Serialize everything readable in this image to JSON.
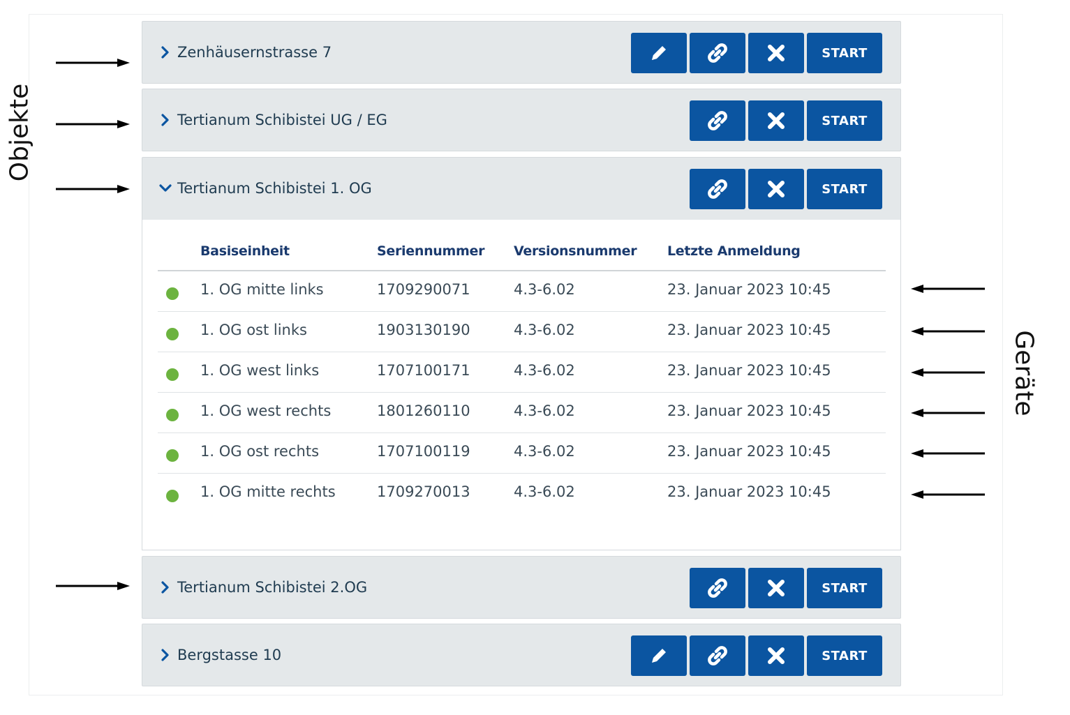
{
  "labels": {
    "objects": "Objekte",
    "devices": "Geräte"
  },
  "buttons": {
    "start_label": "START"
  },
  "objects": [
    {
      "name": "Zenhäusernstrasse 7",
      "expanded": false,
      "has_edit": true
    },
    {
      "name": "Tertianum Schibistei UG / EG",
      "expanded": false,
      "has_edit": false
    },
    {
      "name": "Tertianum Schibistei 1. OG",
      "expanded": true,
      "has_edit": false
    },
    {
      "name": "Tertianum Schibistei 2.OG",
      "expanded": false,
      "has_edit": false
    },
    {
      "name": "Bergstasse 10",
      "expanded": false,
      "has_edit": true
    }
  ],
  "device_table": {
    "headers": [
      "Basiseinheit",
      "Seriennummer",
      "Versionsnummer",
      "Letzte Anmeldung"
    ],
    "rows": [
      {
        "status": "online",
        "name": "1. OG mitte links",
        "serial": "1709290071",
        "version": "4.3-6.02",
        "last_login": "23. Januar 2023 10:45"
      },
      {
        "status": "online",
        "name": "1. OG ost links",
        "serial": "1903130190",
        "version": "4.3-6.02",
        "last_login": "23. Januar 2023 10:45"
      },
      {
        "status": "online",
        "name": "1. OG west links",
        "serial": "1707100171",
        "version": "4.3-6.02",
        "last_login": "23. Januar 2023 10:45"
      },
      {
        "status": "online",
        "name": "1. OG west rechts",
        "serial": "1801260110",
        "version": "4.3-6.02",
        "last_login": "23. Januar 2023 10:45"
      },
      {
        "status": "online",
        "name": "1. OG ost rechts",
        "serial": "1707100119",
        "version": "4.3-6.02",
        "last_login": "23. Januar 2023 10:45"
      },
      {
        "status": "online",
        "name": "1. OG mitte rechts",
        "serial": "1709270013",
        "version": "4.3-6.02",
        "last_login": "23. Januar 2023 10:45"
      }
    ]
  },
  "colors": {
    "button": "#0b55a1",
    "status_online": "#6cb33f",
    "header_bg": "#e4e8ea"
  },
  "icons": {
    "collapsed": "chevron-right-icon",
    "expanded": "chevron-down-icon",
    "edit": "pencil-icon",
    "link": "link-icon",
    "delete": "close-icon"
  }
}
